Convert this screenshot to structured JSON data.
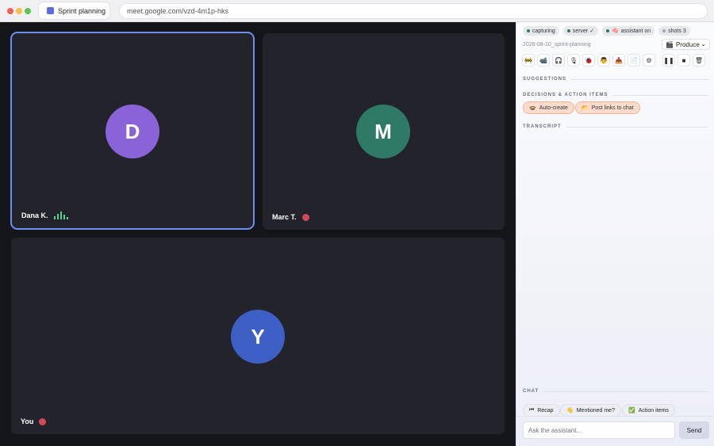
{
  "browser": {
    "tab_title": "Sprint planning",
    "url": "meet.google.com/vzd-4m1p-hks"
  },
  "meeting": {
    "participants": [
      {
        "initial": "D",
        "name": "Dana K.",
        "color": "#8b63d8",
        "speaking": true,
        "muted": false
      },
      {
        "initial": "M",
        "name": "Marc T.",
        "color": "#2e7a66",
        "speaking": false,
        "muted": true
      },
      {
        "initial": "Y",
        "name": "You",
        "color": "#3e5fc6",
        "speaking": false,
        "muted": true
      }
    ]
  },
  "panel": {
    "status": {
      "capturing": "capturing",
      "server": "server ✓",
      "assistant": "assistant on",
      "shots": "shots 3"
    },
    "status_colors": {
      "capturing": "#2f7d5b",
      "server": "#2f7d5b",
      "assistant": "#2f7d5b",
      "shots": "#a0a2ad"
    },
    "filename": "2026-08-10_sprint-planning",
    "mode": {
      "icon": "🎬",
      "selected": "Produce"
    },
    "tools": [
      {
        "name": "cone-icon",
        "glyph": "🚧"
      },
      {
        "name": "camera-icon",
        "glyph": "📹"
      },
      {
        "name": "headphones-icon",
        "glyph": "🎧"
      },
      {
        "name": "mic-icon",
        "glyph": "🎙"
      },
      {
        "name": "bug-icon",
        "glyph": "🐞"
      },
      {
        "name": "person-icon",
        "glyph": "👨"
      },
      {
        "name": "inbox-icon",
        "glyph": "📥"
      },
      {
        "name": "document-icon",
        "glyph": "📄"
      },
      {
        "name": "settings-icon",
        "glyph": "⚙"
      }
    ],
    "controls": [
      {
        "name": "pause-icon",
        "glyph": "❚❚"
      },
      {
        "name": "stop-icon",
        "glyph": "■"
      },
      {
        "name": "trash-icon",
        "glyph": "🗑"
      }
    ],
    "sections": {
      "suggestions": "SUGGESTIONS",
      "decisions": "DECISIONS & ACTION ITEMS",
      "transcript": "TRANSCRIPT",
      "chat": "CHAT"
    },
    "decision_chips": [
      {
        "icon": "🍲",
        "label": "Auto-create"
      },
      {
        "icon": "📂",
        "label": "Post links to chat"
      }
    ],
    "chat_chips": [
      {
        "icon": "⏮",
        "label": "Recap"
      },
      {
        "icon": "👋",
        "label": "Mentioned me?"
      },
      {
        "icon": "✅",
        "label": "Action items"
      }
    ],
    "ask": {
      "placeholder": "Ask the assistant...",
      "send": "Send"
    }
  }
}
